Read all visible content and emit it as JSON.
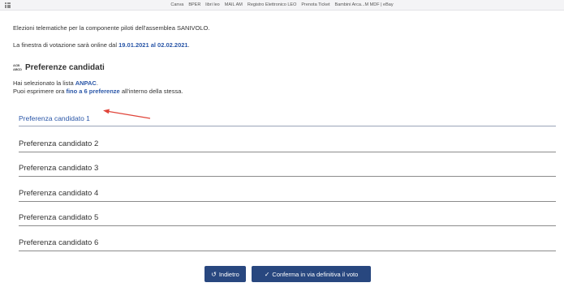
{
  "bookmarks": [
    "Canva",
    "BPER",
    "libri leo",
    "MAIL AM",
    "Registro Elettronico LEO",
    "Prenota Ticket",
    "Bambini Arca...M MDF | eBay"
  ],
  "intro": {
    "line1": "Elezioni telematiche per la componente piloti dell'assemblea SANIVOLO.",
    "line2_prefix": "La finestra di votazione sarà online dal ",
    "line2_dates": "19.01.2021 al 02.02.2021",
    "line2_suffix": "."
  },
  "section": {
    "icon_top": "ACB",
    "icon_bottom": "ABCD",
    "title": "Preferenze candidati"
  },
  "info": {
    "line1_prefix": "Hai selezionato la lista ",
    "list_name": "ANPAC",
    "line1_suffix": ".",
    "line2_prefix": "Puoi esprimere ora ",
    "line2_highlight": "fino a 6 preferenze",
    "line2_suffix": " all'interno della stessa."
  },
  "preferences": [
    "Preferenza candidato 1",
    "Preferenza candidato 2",
    "Preferenza candidato 3",
    "Preferenza candidato 4",
    "Preferenza candidato 5",
    "Preferenza candidato 6"
  ],
  "buttons": {
    "back_icon": "↺",
    "back_label": "Indietro",
    "confirm_icon": "✓",
    "confirm_label": "Conferma in via definitiva il voto"
  },
  "colors": {
    "accent": "#2b57a8",
    "button": "#28477f",
    "arrow": "#e0453a"
  }
}
